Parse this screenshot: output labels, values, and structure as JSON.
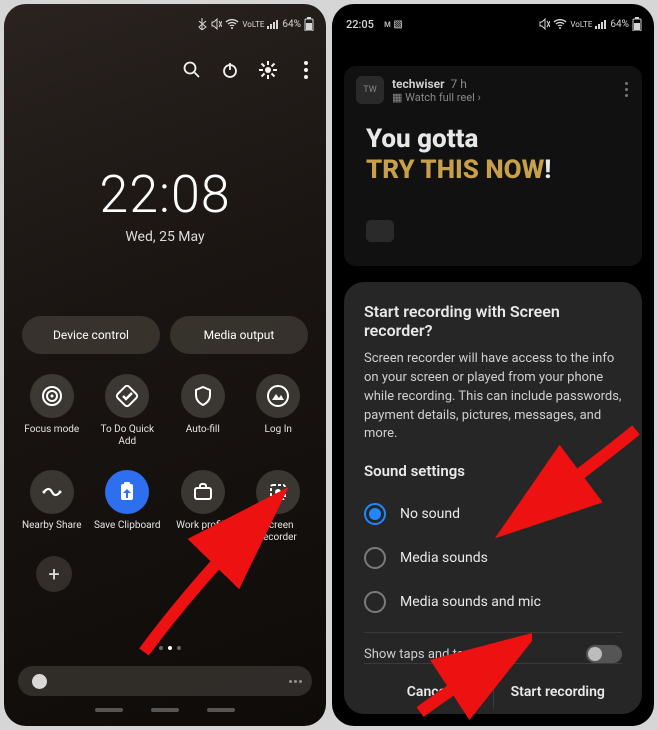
{
  "left": {
    "status": {
      "battery": "64%",
      "net_label": "VoLTE"
    },
    "clock": {
      "time": "22:08",
      "date": "Wed, 25 May"
    },
    "pills": {
      "device_control": "Device control",
      "media_output": "Media output"
    },
    "tiles": [
      {
        "label": "Focus mode",
        "icon": "target",
        "active": false
      },
      {
        "label": "To Do Quick Add",
        "icon": "check",
        "active": false
      },
      {
        "label": "Auto-fill",
        "icon": "shield",
        "active": false
      },
      {
        "label": "Log In",
        "icon": "mountain",
        "active": false
      },
      {
        "label": "Nearby Share",
        "icon": "share",
        "active": false
      },
      {
        "label": "Save Clipboard",
        "icon": "clipboard",
        "active": true
      },
      {
        "label": "Work profile",
        "icon": "briefcase",
        "active": false
      },
      {
        "label": "Screen recorder",
        "icon": "record",
        "active": false
      }
    ]
  },
  "right": {
    "status": {
      "time": "22:05",
      "battery": "64%",
      "net_label": "VoLTE"
    },
    "post": {
      "avatar_initials": "TW",
      "username": "techwiser",
      "age": "7 h",
      "subline": "Watch full reel",
      "headline_line1": "You gotta",
      "headline_line2": "TRY THIS NOW",
      "headline_punct": "!"
    },
    "sheet": {
      "title": "Start recording with Screen recorder?",
      "body": "Screen recorder will have access to the info on your screen or played from your phone while recording. This can include passwords, payment details, pictures, messages, and more.",
      "sound_label": "Sound settings",
      "options": [
        {
          "label": "No sound",
          "checked": true
        },
        {
          "label": "Media sounds",
          "checked": false
        },
        {
          "label": "Media sounds and mic",
          "checked": false
        }
      ],
      "toggle_label": "Show taps and touches",
      "toggle_on": false,
      "cancel": "Cancel",
      "start": "Start recording"
    }
  }
}
